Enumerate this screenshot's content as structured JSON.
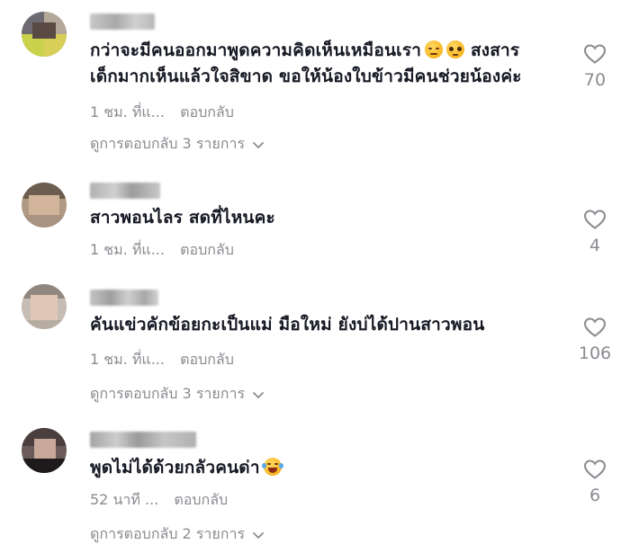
{
  "comments": [
    {
      "text_line1": "กว่าจะมีคนออกมาพูดความคิดเห็นเหมือนเรา",
      "text_line1_tail": "สงสาร",
      "text_line2": "เด็กมากเห็นแล้วใจสิขาด ขอให้น้องใบข้าวมีคนช่วยน้องค่ะ",
      "emojis": [
        "pensive-face-emoji",
        "pleading-face-emoji"
      ],
      "time": "1 ชม. ที่แ...",
      "reply_label": "ตอบกลับ",
      "view_replies": "ดูการตอบกลับ 3 รายการ",
      "likes": "70"
    },
    {
      "text": "สาวพอนไลร สดที่ไหนคะ",
      "time": "1 ชม. ที่แ...",
      "reply_label": "ตอบกลับ",
      "likes": "4"
    },
    {
      "text": "คันแข่วคักข้อยกะเป็นแม่ มือใหม่ ยังบ่ได้ปานสาวพอน",
      "time": "1 ชม. ที่แ...",
      "reply_label": "ตอบกลับ",
      "view_replies": "ดูการตอบกลับ 3 รายการ",
      "likes": "106"
    },
    {
      "text": "พูดไม่ได้ด้วยกลัวคนด่า",
      "emojis": [
        "laughing-tears-emoji"
      ],
      "time": "52 นาที ...",
      "reply_label": "ตอบกลับ",
      "view_replies": "ดูการตอบกลับ 2 รายการ",
      "likes": "6"
    }
  ],
  "colors": {
    "text": "#161823",
    "muted": "#8a8b91",
    "heart_stroke": "#8a8b91"
  },
  "icons": {
    "like": "heart-outline-icon",
    "expand": "chevron-down-icon"
  }
}
